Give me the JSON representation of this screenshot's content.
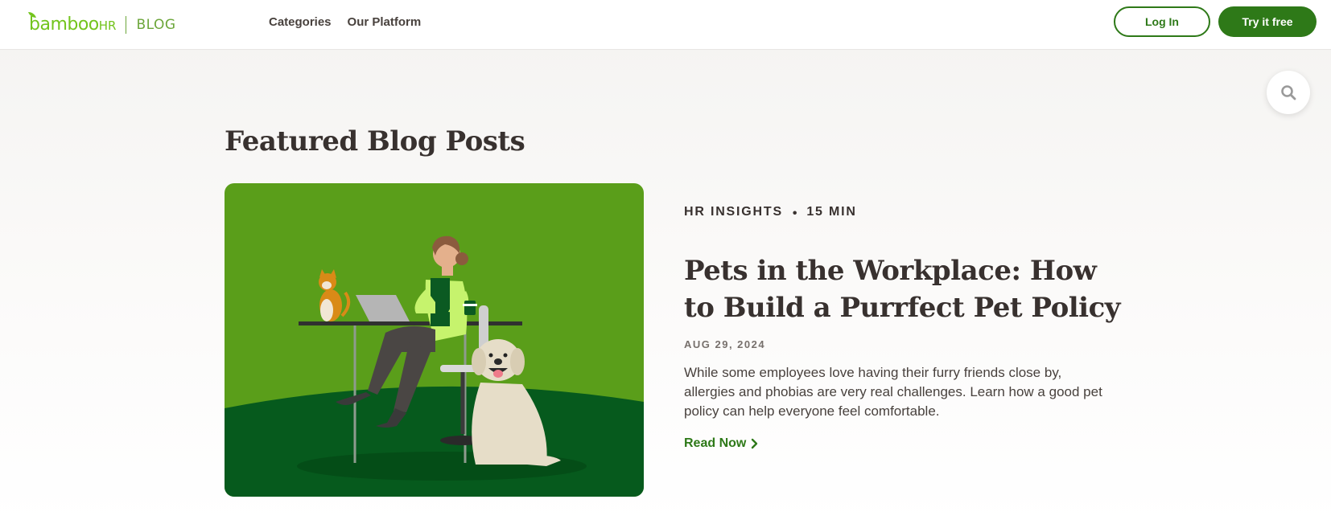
{
  "header": {
    "logo_text": "bamboo",
    "logo_hr": "HR",
    "logo_section": "BLOG",
    "nav": [
      {
        "label": "Categories"
      },
      {
        "label": "Our Platform"
      }
    ],
    "login_label": "Log In",
    "try_label": "Try it free"
  },
  "search": {
    "icon": "search-icon"
  },
  "featured": {
    "section_title": "Featured Blog Posts",
    "post": {
      "category": "HR INSIGHTS",
      "read_time": "15 MIN",
      "title": "Pets in the Workplace: How to Build a Purrfect Pet Policy",
      "date": "AUG 29, 2024",
      "excerpt": "While some employees love having their furry friends close by, allergies and phobias are very real challenges. Learn how a good pet policy can help everyone feel comfortable.",
      "cta": "Read Now"
    }
  },
  "colors": {
    "brand_green": "#2e7918",
    "logo_green": "#73c41d",
    "text_dark": "#38312f",
    "image_bg": "#5a9e1a"
  }
}
